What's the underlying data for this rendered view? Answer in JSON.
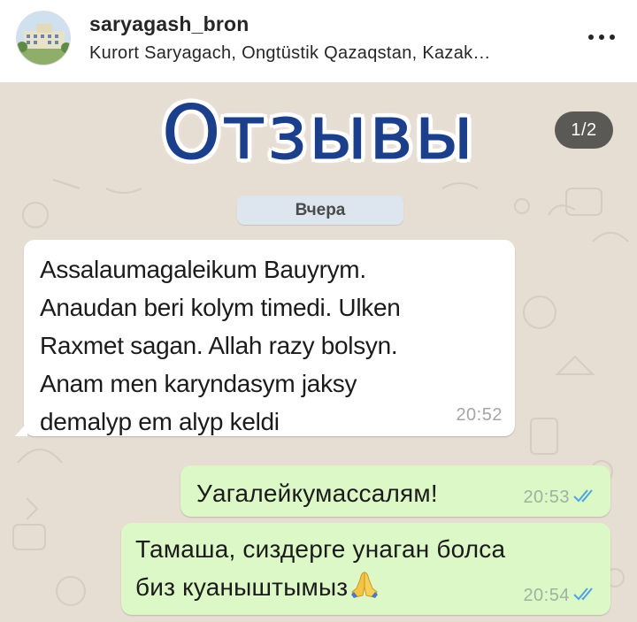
{
  "header": {
    "username": "saryagash_bron",
    "location": "Kurort Saryagach, Ongtüstik Qazaqstan, Kazak…",
    "more_icon": "more-horizontal-icon"
  },
  "post": {
    "title": "Отзывы",
    "page_indicator": "1/2",
    "chat": {
      "date_label": "Вчера",
      "messages": [
        {
          "direction": "incoming",
          "lines": [
            "Assalaumagaleikum Bauyrym.",
            "Anaudan beri kolym timedi. Ulken",
            "Raxmet sagan. Allah razy bolsyn.",
            "Anam men karyndasym jaksy",
            "demalyp em alyp keldi"
          ],
          "time": "20:52"
        },
        {
          "direction": "outgoing",
          "lines": [
            "Уагалейкумассалям!"
          ],
          "time": "20:53",
          "status_icon": "double-check-read-icon"
        },
        {
          "direction": "outgoing",
          "lines": [
            "Тамаша, сиздерге унаган болса",
            "биз куаныштымыз"
          ],
          "emoji": "folded-hands-emoji",
          "time": "20:54",
          "status_icon": "double-check-read-icon"
        }
      ]
    }
  },
  "colors": {
    "title_blue": "#1c3f8c",
    "chat_wallpaper": "#e6ddd3",
    "incoming_bubble": "#ffffff",
    "outgoing_bubble": "#dcf8c6",
    "read_tick_blue": "#4fa3e0",
    "date_chip": "#dde6ef"
  }
}
